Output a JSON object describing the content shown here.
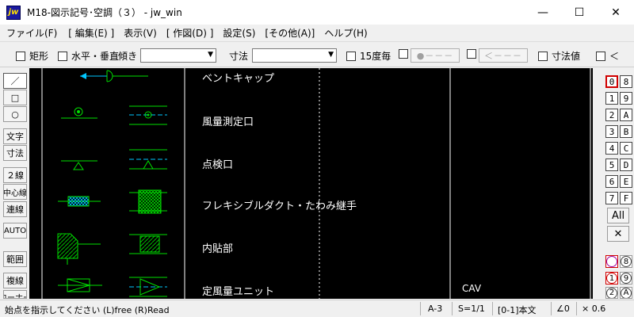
{
  "window": {
    "title": "M18-図示記号･空調（３） - jw_win",
    "app_icon_text": "jw",
    "minimize": "—",
    "maximize": "☐",
    "close": "✕"
  },
  "menu": [
    "ファイル(F)",
    "[ 編集(E) ]",
    "表示(V)",
    "[ 作図(D) ]",
    "設定(S)",
    "[その他(A)]",
    "ヘルプ(H)"
  ],
  "toolbar": {
    "rect_label": "矩形",
    "hv_label": "水平・垂直",
    "tilt_label": "傾き",
    "tilt_value": "",
    "dim_label": "寸法",
    "dim_value": "",
    "deg15_label": "15度毎",
    "btn_a": "●－－－",
    "btn_b": "＜－－－",
    "dimval_label": "寸法値",
    "lt_label": "＜"
  },
  "left_tools": [
    "／",
    "□",
    "○",
    "文字",
    "寸法",
    "２線",
    "中心線",
    "連線",
    "AUTO",
    "範囲",
    "複線",
    "コーナー"
  ],
  "right_layers": {
    "col1": [
      "0",
      "1",
      "2",
      "3",
      "4",
      "5",
      "6",
      "7"
    ],
    "col2": [
      "8",
      "9",
      "A",
      "B",
      "C",
      "D",
      "E",
      "F"
    ],
    "all_label": "All",
    "x_label": "✕",
    "bottom_col1": [
      "",
      "1",
      "2"
    ],
    "bottom_col2": [
      "8",
      "9",
      "A"
    ]
  },
  "canvas": {
    "labels": [
      "ベントキャップ",
      "風量測定口",
      "点検口",
      "フレキシブルダクト・たわみ継手",
      "内貼部",
      "定風量ユニット"
    ],
    "extra_label": "CAV",
    "colors": {
      "background": "#000000",
      "green": "#00e000",
      "cyan": "#00c8ff",
      "white": "#ffffff"
    }
  },
  "status": {
    "message": "始点を指示してください (L)free (R)Read",
    "paper": "A-3",
    "scale": "S=1/1",
    "layer": "[0-1]本文",
    "angle": "∠0",
    "mult": "× 0.6"
  }
}
